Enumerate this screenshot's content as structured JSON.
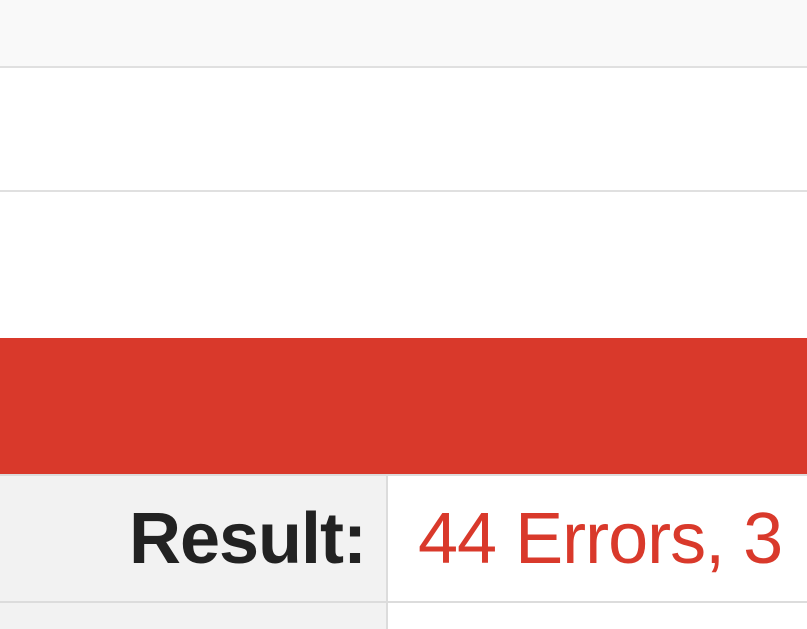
{
  "validation": {
    "result_label": "Result:",
    "result_value": "44 Errors, 3",
    "status_color": "#d9392b"
  }
}
